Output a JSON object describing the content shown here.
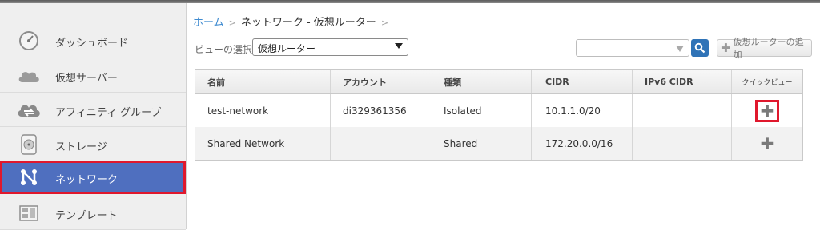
{
  "sidebar": {
    "items": [
      {
        "label": "ダッシュボード",
        "icon": "dashboard-gauge-icon"
      },
      {
        "label": "仮想サーバー",
        "icon": "cloud-icon"
      },
      {
        "label": "アフィニティ グループ",
        "icon": "affinity-cloud-icon"
      },
      {
        "label": "ストレージ",
        "icon": "storage-disk-icon"
      },
      {
        "label": "ネットワーク",
        "icon": "network-icon",
        "active": true
      },
      {
        "label": "テンプレート",
        "icon": "template-icon"
      }
    ]
  },
  "breadcrumb": {
    "home": "ホーム",
    "sep1": ">",
    "current": "ネットワーク - 仮想ルーター",
    "sep2": ">"
  },
  "toolbar": {
    "view_label": "ビューの選択:",
    "view_value": "仮想ルーター",
    "search_value": "",
    "add_label": "仮想ルーターの追加"
  },
  "table": {
    "columns": [
      "名前",
      "アカウント",
      "種類",
      "CIDR",
      "IPv6 CIDR",
      "クイックビュー"
    ],
    "rows": [
      {
        "name": "test-network",
        "account": "di329361356",
        "type": "Isolated",
        "cidr": "10.1.1.0/20",
        "ipv6": ""
      },
      {
        "name": "Shared Network",
        "account": "",
        "type": "Shared",
        "cidr": "172.20.0.0/16",
        "ipv6": ""
      }
    ]
  },
  "colors": {
    "accent": "#4f6fbf",
    "highlight": "#e0182d",
    "link": "#3f8bd0"
  }
}
